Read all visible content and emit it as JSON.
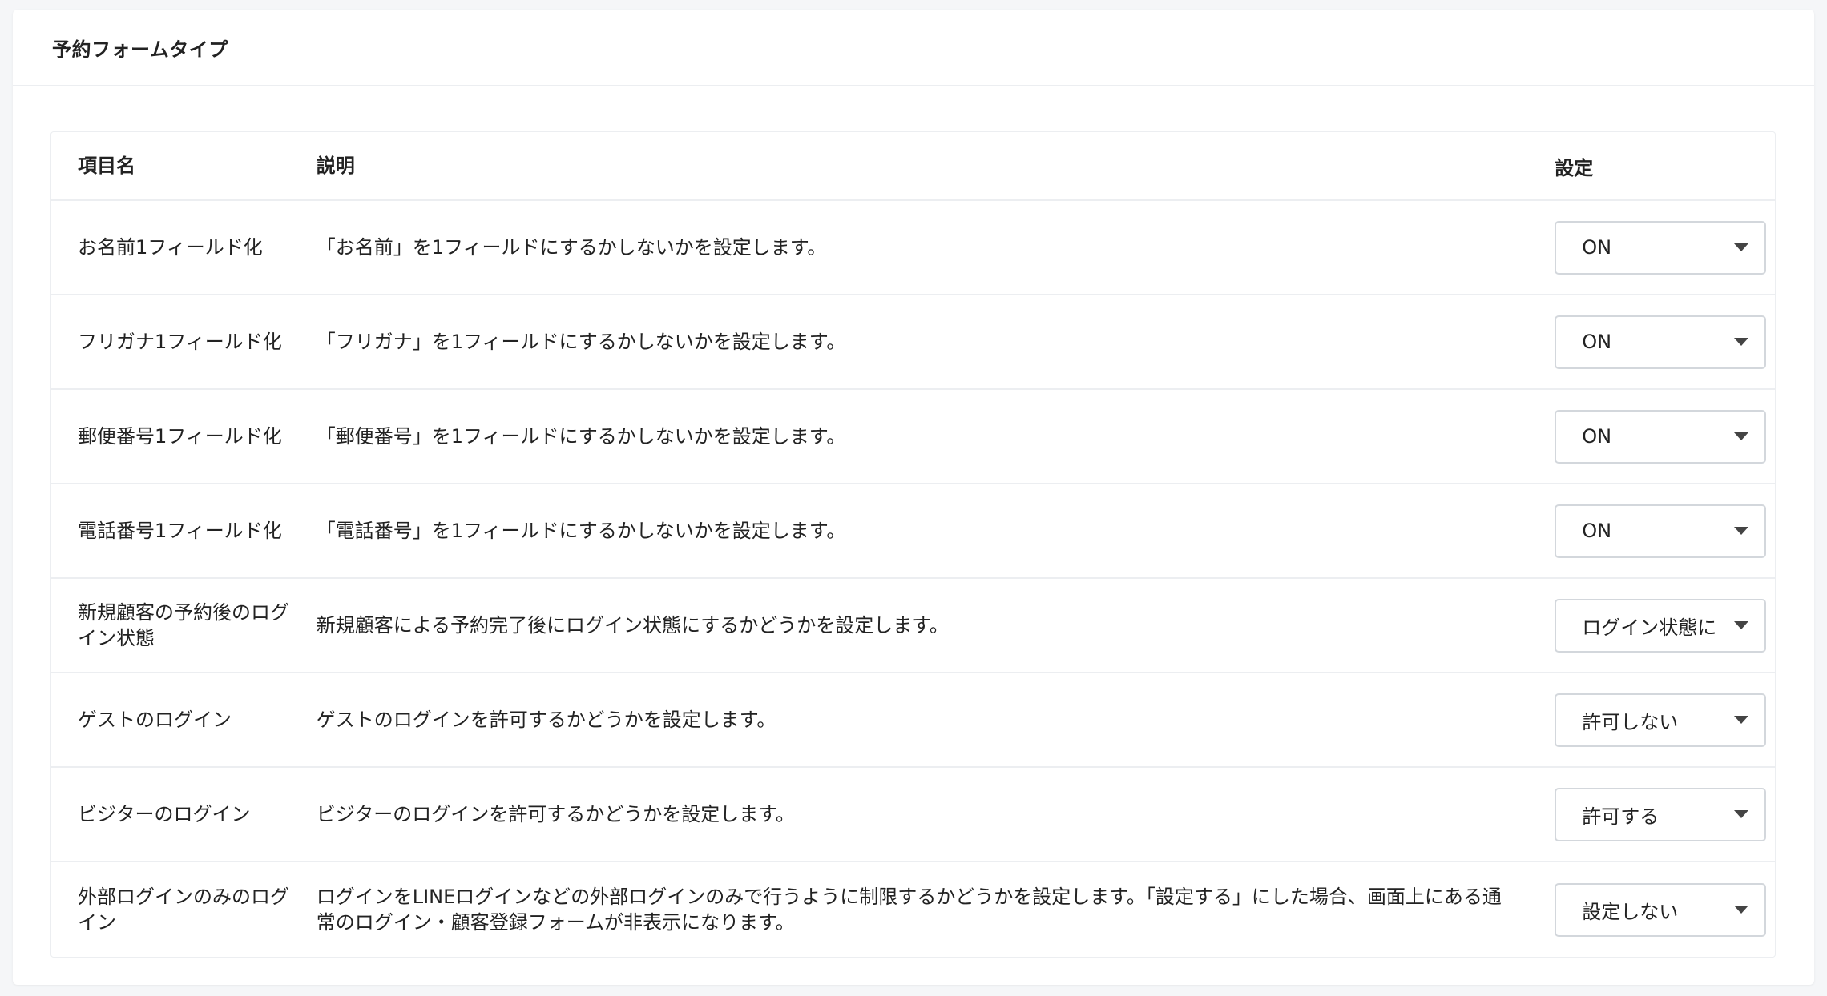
{
  "card": {
    "title": "予約フォームタイプ"
  },
  "table": {
    "headers": {
      "name": "項目名",
      "description": "説明",
      "setting": "設定"
    },
    "rows": [
      {
        "name": "お名前1フィールド化",
        "description": "「お名前」を1フィールドにするかしないかを設定します。",
        "value": "ON"
      },
      {
        "name": "フリガナ1フィールド化",
        "description": "「フリガナ」を1フィールドにするかしないかを設定します。",
        "value": "ON"
      },
      {
        "name": "郵便番号1フィールド化",
        "description": "「郵便番号」を1フィールドにするかしないかを設定します。",
        "value": "ON"
      },
      {
        "name": "電話番号1フィールド化",
        "description": "「電話番号」を1フィールドにするかしないかを設定します。",
        "value": "ON"
      },
      {
        "name": "新規顧客の予約後のログイン状態",
        "description": "新規顧客による予約完了後にログイン状態にするかどうかを設定します。",
        "value": "ログイン状態に"
      },
      {
        "name": "ゲストのログイン",
        "description": "ゲストのログインを許可するかどうかを設定します。",
        "value": "許可しない"
      },
      {
        "name": "ビジターのログイン",
        "description": "ビジターのログインを許可するかどうかを設定します。",
        "value": "許可する"
      },
      {
        "name": "外部ログインのみのログイン",
        "description": "ログインをLINEログインなどの外部ログインのみで行うように制限するかどうかを設定します。「設定する」にした場合、画面上にある通常のログイン・顧客登録フォームが非表示になります。",
        "value": "設定しない"
      }
    ]
  }
}
